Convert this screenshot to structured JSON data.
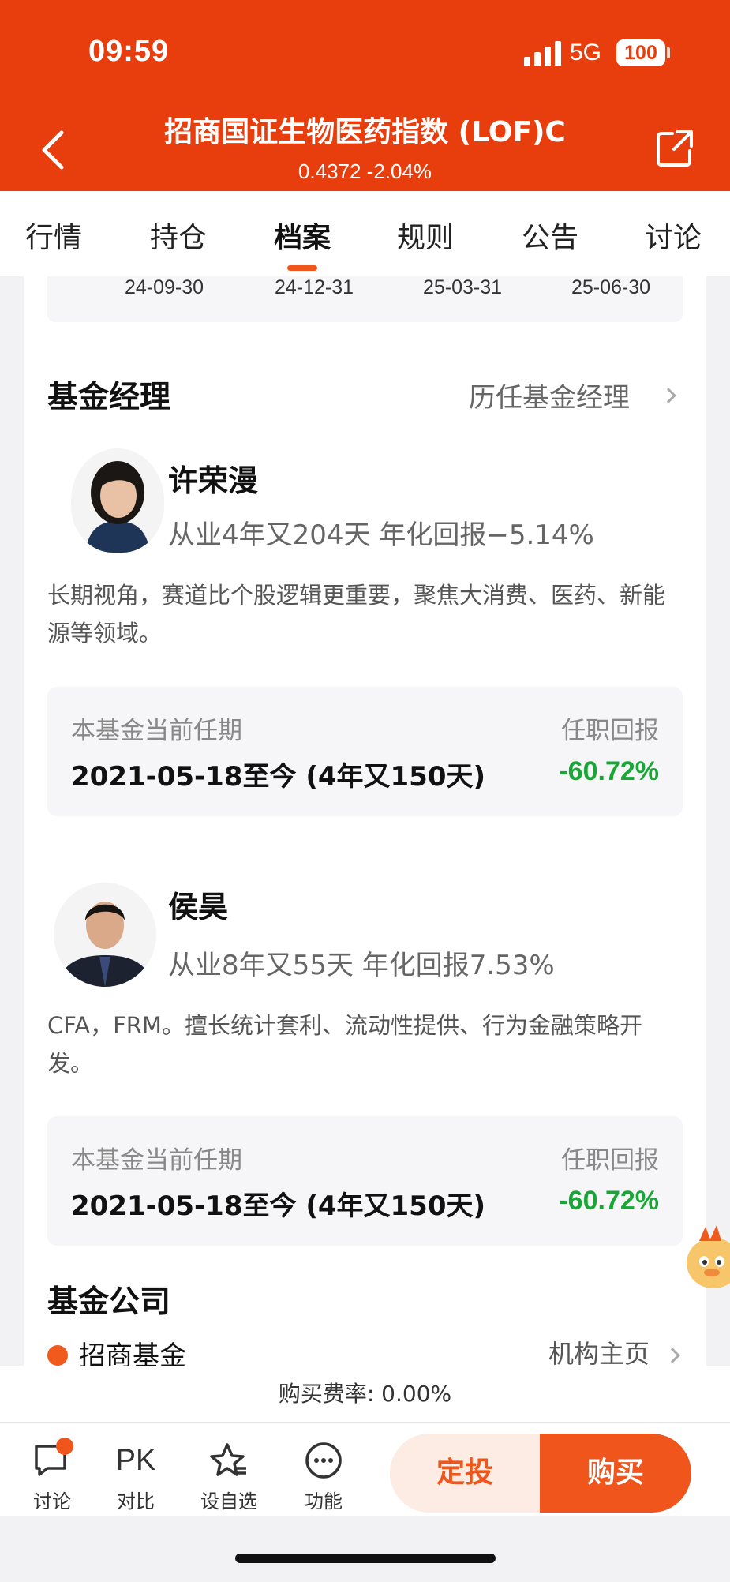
{
  "status": {
    "time": "09:59",
    "network": "5G",
    "battery": "100"
  },
  "header": {
    "title": "招商国证生物医药指数 (LOF)C",
    "price_change": "0.4372 -2.04%"
  },
  "tabs": [
    {
      "label": "行情"
    },
    {
      "label": "持仓"
    },
    {
      "label": "档案"
    },
    {
      "label": "规则"
    },
    {
      "label": "公告"
    },
    {
      "label": "讨论"
    }
  ],
  "report_dates": [
    "24-09-30",
    "24-12-31",
    "25-03-31",
    "25-06-30"
  ],
  "managers_section": {
    "title": "基金经理",
    "history_link": "历任基金经理"
  },
  "managers": [
    {
      "name": "许荣漫",
      "stats": "从业4年又204天 年化回报−5.14%",
      "description": "长期视角，赛道比个股逻辑更重要，聚焦大消费、医药、新能源等领域。",
      "tenure_label": "本基金当前任期",
      "tenure_range": "2021-05-18至今 (4年又150天)",
      "return_label": "任职回报",
      "return_value": "-60.72%"
    },
    {
      "name": "侯昊",
      "stats": "从业8年又55天 年化回报7.53%",
      "description": "CFA，FRM。擅长统计套利、流动性提供、行为金融策略开发。",
      "tenure_label": "本基金当前任期",
      "tenure_range": "2021-05-18至今 (4年又150天)",
      "return_label": "任职回报",
      "return_value": "-60.72%"
    }
  ],
  "company_section": {
    "title": "基金公司",
    "company_name": "招商基金",
    "link": "机构主页"
  },
  "fee": {
    "text": "购买费率: 0.00%"
  },
  "bottom_bar": {
    "discuss": "讨论",
    "pk_glyph": "PK",
    "compare": "对比",
    "watchlist": "设自选",
    "function": "功能",
    "dingtou": "定投",
    "buy": "购买"
  },
  "colors": {
    "brand": "#e83e0d",
    "accent": "#f0561c",
    "negative_return": "#1aa636"
  }
}
